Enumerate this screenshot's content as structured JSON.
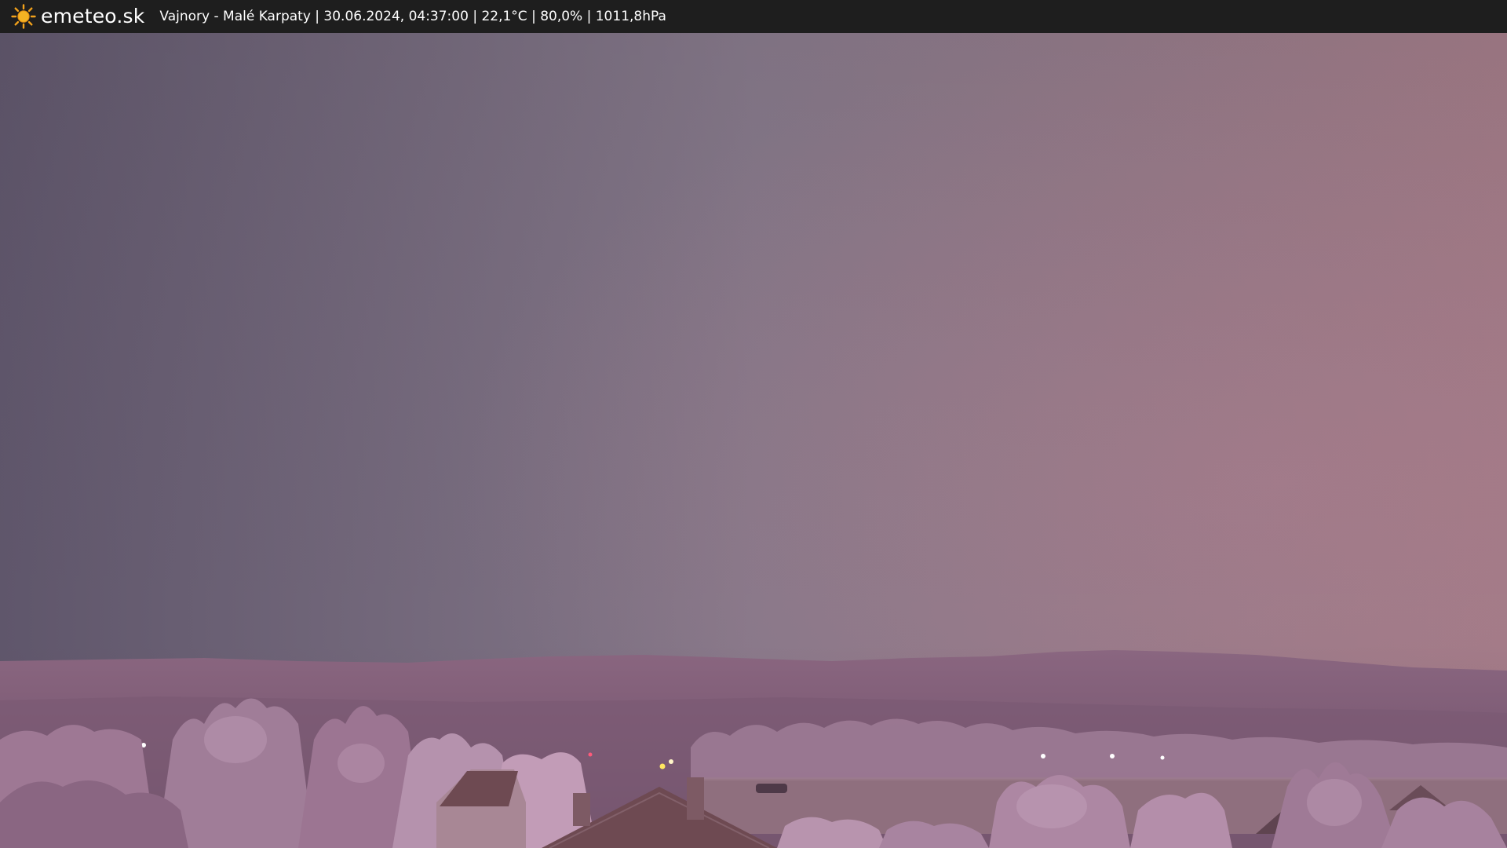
{
  "header": {
    "brand": "emeteo.sk",
    "logo_icon": "sun-icon",
    "caption": "Vajnory - Malé Karpaty | 30.06.2024, 04:37:00 | 22,1°C | 80,0% | 1011,8hPa"
  },
  "webcam": {
    "colors": {
      "sky_left": "#5f566b",
      "sky_center": "#857889",
      "sky_right": "#a07a86",
      "hills": "#7a5a73",
      "trees": "#b58aa8",
      "field": "#8f6f7e",
      "roof": "#6e4a52"
    }
  }
}
